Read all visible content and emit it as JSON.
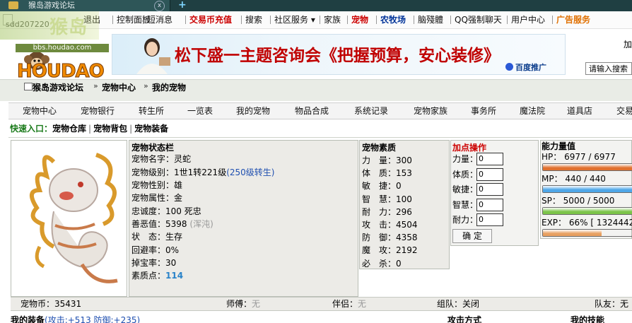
{
  "browser": {
    "tab_title": "猴岛游戏论坛",
    "new_tab": "+",
    "close": "x"
  },
  "topnav": {
    "items": [
      {
        "label": "退出",
        "style": ""
      },
      {
        "label": "控制面板",
        "style": ""
      },
      {
        "label": "短消息",
        "style": ""
      },
      {
        "label": "交易币充值",
        "style": "red"
      },
      {
        "label": "搜索",
        "style": ""
      },
      {
        "label": "社区服务 ▾",
        "style": ""
      },
      {
        "label": "家族",
        "style": ""
      },
      {
        "label": "宠物",
        "style": "red"
      },
      {
        "label": "农牧场",
        "style": "blue"
      },
      {
        "label": "脑殘體",
        "style": ""
      },
      {
        "label": "QQ强制聊天",
        "style": ""
      },
      {
        "label": "用户中心",
        "style": ""
      },
      {
        "label": "广告服务",
        "style": "orange"
      }
    ]
  },
  "logo": {
    "watermark_user": "sdd207220",
    "watermark_text": "猴岛",
    "url": "bbs.houdao.com",
    "name": "HOUDAO"
  },
  "banner": {
    "text": "松下盛一主题咨询会《把握预算，安心装修》",
    "ad_label": "百度推广"
  },
  "right": {
    "cut_label": "加",
    "search_placeholder": "请输入搜索"
  },
  "breadcrumb": [
    "猴岛游戏论坛",
    "宠物中心",
    "我的宠物"
  ],
  "subnav": [
    "宠物中心",
    "宠物银行",
    "转生所",
    "一览表",
    "我的宠物",
    "物品合成",
    "系统记录",
    "宠物家族",
    "事务所",
    "魔法院",
    "道具店",
    "交易"
  ],
  "quick": {
    "label": "快速入口：",
    "links": [
      "宠物仓库",
      "宠物背包",
      "宠物装备"
    ]
  },
  "status": {
    "title": "宠物状态栏",
    "name_label": "宠物名字：",
    "name": "灵蛇",
    "level_label": "宠物级别：",
    "level": "1世1转221级",
    "level_note": "(250级转生)",
    "gender_label": "宠物性别：",
    "gender": "雄",
    "element_label": "宠物属性：",
    "element": "金",
    "loyalty_label": "忠诚度：",
    "loyalty": "100 死忠",
    "karma_label": "善恶值：",
    "karma": "5398",
    "karma_note": "(浑沌)",
    "state_label": "状　态：",
    "state": "生存",
    "dodge_label": "回避率：",
    "dodge": "0%",
    "drop_label": "掉宝率：",
    "drop": "30",
    "points_label": "素质点：",
    "points": "114"
  },
  "attributes": {
    "title": "宠物素质",
    "rows": [
      {
        "label": "力　量：",
        "value": "300"
      },
      {
        "label": "体　质：",
        "value": "153"
      },
      {
        "label": "敏　捷：",
        "value": "0"
      },
      {
        "label": "智　慧：",
        "value": "100"
      },
      {
        "label": "耐　力：",
        "value": "296"
      },
      {
        "label": "攻　击：",
        "value": "4504"
      },
      {
        "label": "防　御：",
        "value": "4358"
      },
      {
        "label": "魔　攻：",
        "value": "2192"
      },
      {
        "label": "必　杀：",
        "value": "0"
      }
    ]
  },
  "addpoints": {
    "title": "加点操作",
    "rows": [
      {
        "label": "力量：",
        "value": "0"
      },
      {
        "label": "体质：",
        "value": "0"
      },
      {
        "label": "敏捷：",
        "value": "0"
      },
      {
        "label": "智慧：",
        "value": "0"
      },
      {
        "label": "耐力：",
        "value": "0"
      }
    ],
    "confirm": "确 定"
  },
  "power": {
    "title": "能力量值",
    "hp_label": "HP： 6977 / 6977",
    "hp_fill": 1.0,
    "hp_color": "#e0702e",
    "mp_label": "MP： 440 / 440",
    "mp_fill": 1.0,
    "mp_color": "#4fa7e8",
    "sp_label": "SP： 5000 / 5000",
    "sp_fill": 1.0,
    "sp_color": "#7cc44a",
    "exp_label": "EXP： 66% [ 1324442",
    "exp_fill": 0.66,
    "exp_color": "#e8a060"
  },
  "bottom": {
    "coins_label": "宠物币：",
    "coins": "35431",
    "master_label": "师傅：",
    "master": "无",
    "partner_label": "伴侣：",
    "partner": "无",
    "team_label": "组队：",
    "team": "关闭",
    "teammate_label": "队友：",
    "teammate": "无"
  },
  "lastrow": {
    "equip": "我的装备",
    "equip_note": "(攻击:+513 防御:+235)",
    "attack_mode": "攻击方式",
    "skills": "我的技能"
  }
}
